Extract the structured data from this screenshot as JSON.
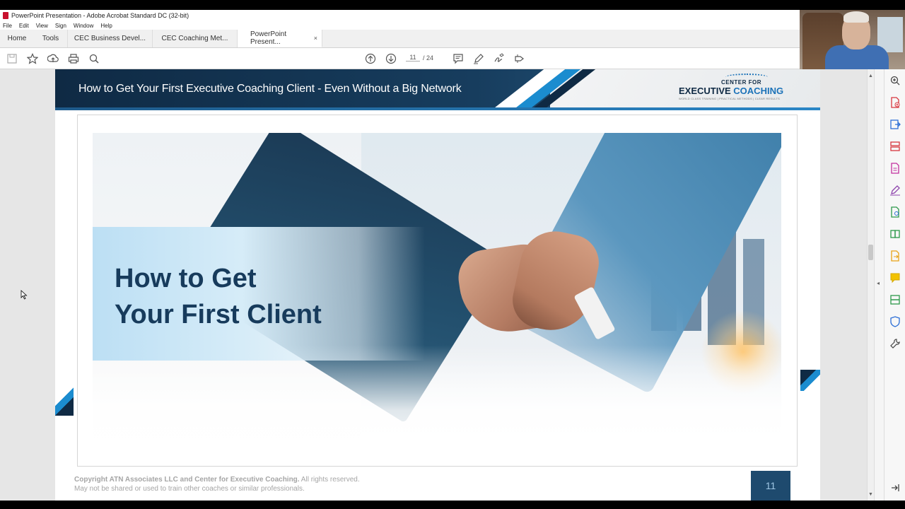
{
  "window": {
    "title": "PowerPoint Presentation - Adobe Acrobat Standard DC (32-bit)",
    "menu": [
      "File",
      "Edit",
      "View",
      "Sign",
      "Window",
      "Help"
    ]
  },
  "tabs": {
    "home": "Home",
    "tools": "Tools",
    "docs": [
      "CEC Business Devel...",
      "CEC Coaching Met...",
      "PowerPoint Present..."
    ],
    "close": "×"
  },
  "toolbar": {
    "page_current": "11",
    "page_total": "/  24",
    "icons": [
      "save-icon",
      "bookmark-star-icon",
      "upload-icon",
      "print-icon",
      "zoom-icon",
      "prev-page-icon",
      "next-page-icon",
      "comment-icon",
      "highlight-icon",
      "sign-icon",
      "share-icon"
    ]
  },
  "slide": {
    "header_title": "How to Get Your First Executive Coaching Client - Even Without a Big Network",
    "logo": {
      "line1": "CENTER FOR",
      "line2a": "EXECUTIVE ",
      "line2b": "COACHING",
      "tagline": "WORLD CLASS TRAINING | PRACTICAL METHODS | CLEAR RESULTS"
    },
    "main_title": "How to Get\nYour First Client",
    "footer_bold": "Copyright ATN Associates LLC and Center for Executive Coaching.",
    "footer_rest": " All rights reserved.",
    "footer_line2": "May not be shared or used to train other coaches or similar professionals.",
    "page_number": "11"
  },
  "right_tools": [
    "zoom-tool-icon",
    "create-pdf-icon",
    "export-pdf-icon",
    "organize-pages-icon",
    "edit-pdf-icon",
    "fill-sign-icon",
    "send-review-icon",
    "compare-icon",
    "export-icon",
    "comment-tool-icon",
    "scan-icon",
    "protect-icon",
    "more-tools-icon",
    "collapse-pane-icon"
  ],
  "colors": {
    "navy": "#0f2a44",
    "accent_blue": "#1b8ccf",
    "title_blue": "#173b5c"
  }
}
